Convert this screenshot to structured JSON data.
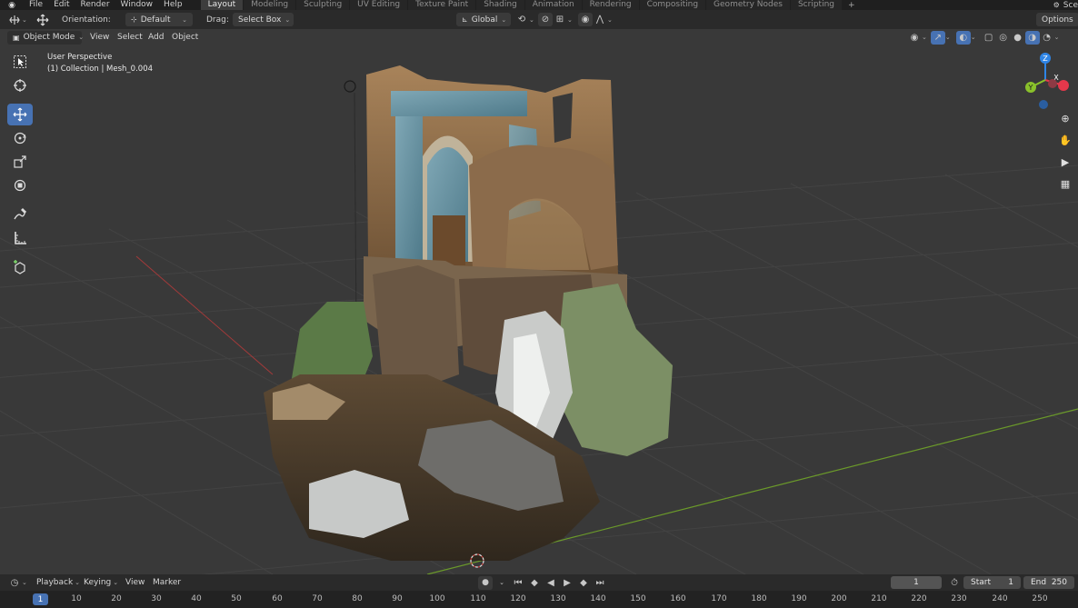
{
  "menu": {
    "items": [
      "File",
      "Edit",
      "Render",
      "Window",
      "Help"
    ],
    "scene_label": "Sce"
  },
  "workspaces": {
    "tabs": [
      "Layout",
      "Modeling",
      "Sculpting",
      "UV Editing",
      "Texture Paint",
      "Shading",
      "Animation",
      "Rendering",
      "Compositing",
      "Geometry Nodes",
      "Scripting"
    ],
    "active": "Layout",
    "add": "+"
  },
  "tool_header": {
    "orientation_label": "Orientation:",
    "orientation_value": "Default",
    "drag_label": "Drag:",
    "drag_value": "Select Box",
    "transform_space": "Global",
    "options_label": "Options"
  },
  "viewport_header": {
    "mode": "Object Mode",
    "menus": [
      "View",
      "Select",
      "Add",
      "Object"
    ]
  },
  "viewport": {
    "perspective_text": "User Perspective",
    "collection_text": "(1) Collection | Mesh_0.004"
  },
  "gizmo": {
    "x_label": "X",
    "y_label": "Y",
    "z_label": "Z",
    "x_color": "#e5384b",
    "y_color": "#8ac12b",
    "z_color": "#2f85e6"
  },
  "timeline": {
    "menus": [
      "Playback",
      "Keying",
      "View",
      "Marker"
    ],
    "current_frame": "1",
    "start_label": "Start",
    "start_value": "1",
    "end_label": "End",
    "end_value": "250"
  },
  "ruler": {
    "ticks": [
      "10",
      "20",
      "30",
      "40",
      "50",
      "60",
      "70",
      "80",
      "90",
      "100",
      "110",
      "120",
      "130",
      "140",
      "150",
      "160",
      "170",
      "180",
      "190",
      "200",
      "210",
      "220",
      "230",
      "240",
      "250"
    ],
    "current": "1"
  },
  "colors": {
    "accent": "#4772b3",
    "viewport_bg": "#393939",
    "header_bg": "#2a2a2a"
  }
}
